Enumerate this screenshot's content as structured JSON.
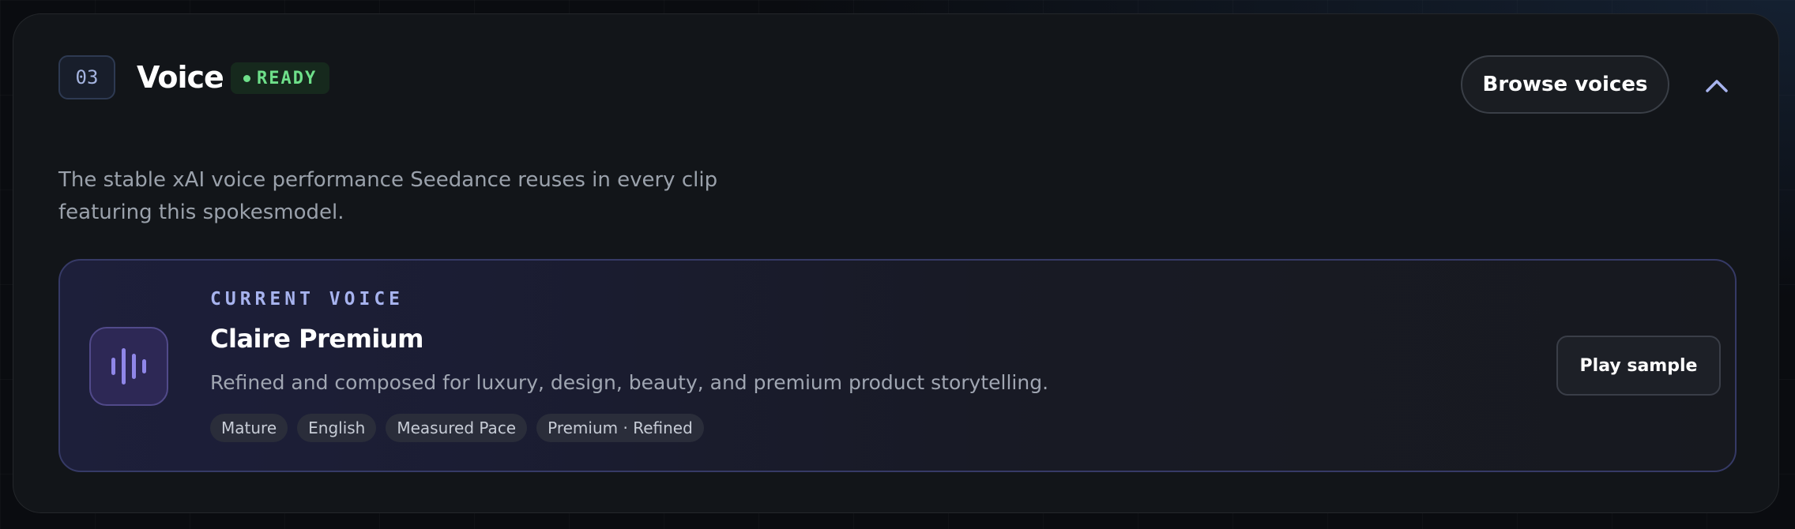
{
  "section": {
    "step": "03",
    "title": "Voice",
    "status": "READY",
    "browse_label": "Browse voices",
    "description": "The stable xAI voice performance Seedance reuses in every clip featuring this spokesmodel."
  },
  "current_voice": {
    "eyebrow": "CURRENT VOICE",
    "name": "Claire Premium",
    "description": "Refined and composed for luxury, design, beauty, and premium product storytelling.",
    "tags": [
      "Mature",
      "English",
      "Measured Pace",
      "Premium · Refined"
    ],
    "play_label": "Play sample"
  },
  "icons": {
    "collapse": "chevron-up-icon",
    "voice": "waveform-icon"
  },
  "colors": {
    "status_green": "#6ee08a",
    "accent": "#a7b3ee",
    "voice_icon": "#8f86e8"
  }
}
